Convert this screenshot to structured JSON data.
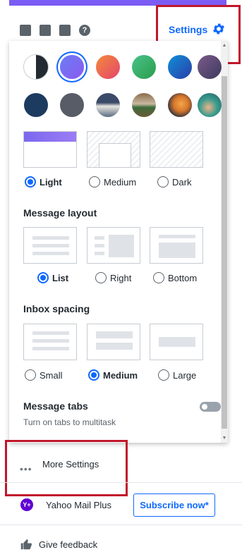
{
  "header": {
    "settings_label": "Settings"
  },
  "toolbar_icons": [
    "contacts-icon",
    "calendar-icon",
    "notepad-icon",
    "help-icon"
  ],
  "help_glyph": "?",
  "themes": {
    "colors": [
      "#232a31",
      "#7b68ee",
      "#ef5d4e",
      "#2fb35c",
      "#1a6fd1",
      "#5b4a78",
      "#1d3a5f",
      "#575c66"
    ],
    "photo_swatches": [
      "mountain-photo",
      "field-photo",
      "autumn-photo",
      "beach-photo"
    ],
    "selected": 1
  },
  "brightness": {
    "options": [
      "Light",
      "Medium",
      "Dark"
    ],
    "selected": "Light"
  },
  "message_layout": {
    "title": "Message layout",
    "options": [
      "List",
      "Right",
      "Bottom"
    ],
    "selected": "List"
  },
  "inbox_spacing": {
    "title": "Inbox spacing",
    "options": [
      "Small",
      "Medium",
      "Large"
    ],
    "selected": "Medium"
  },
  "message_tabs": {
    "title": "Message tabs",
    "subtitle": "Turn on tabs to multitask",
    "enabled": false
  },
  "footer": {
    "more_settings": "More Settings",
    "mail_plus": "Yahoo Mail Plus",
    "subscribe": "Subscribe now*",
    "feedback": "Give feedback",
    "logo_text": "Y+"
  }
}
